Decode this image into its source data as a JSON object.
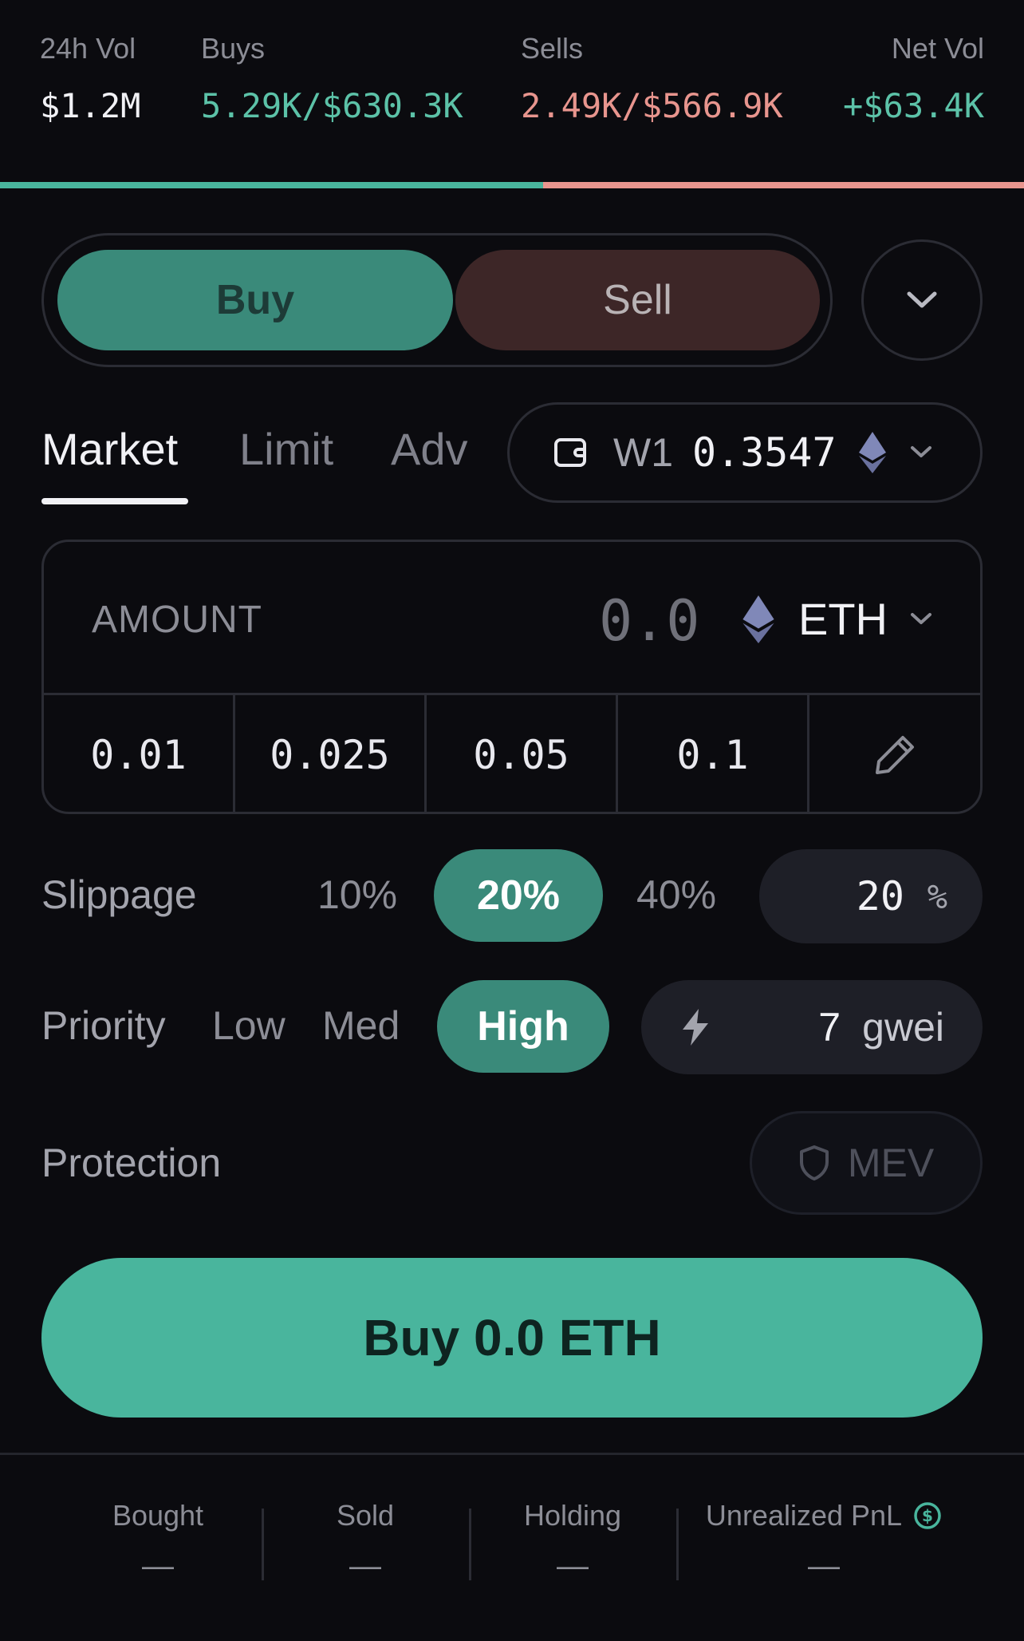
{
  "stats": {
    "vol_label": "24h Vol",
    "vol_value": "$1.2M",
    "buys_label": "Buys",
    "buys_value": "5.29K/$630.3K",
    "sells_label": "Sells",
    "sells_value": "2.49K/$566.9K",
    "net_label": "Net Vol",
    "net_value": "+$63.4K",
    "buy_share": 0.53
  },
  "toggle": {
    "buy_label": "Buy",
    "sell_label": "Sell"
  },
  "order_tabs": {
    "market": "Market",
    "limit": "Limit",
    "adv": "Adv",
    "active": "Market"
  },
  "wallet": {
    "name": "W1",
    "balance": "0.3547",
    "icon": "wallet-icon",
    "token_icon": "eth-icon"
  },
  "amount": {
    "label": "AMOUNT",
    "value": "0.0",
    "token": "ETH"
  },
  "presets": [
    "0.01",
    "0.025",
    "0.05",
    "0.1"
  ],
  "slippage": {
    "label": "Slippage",
    "opt1": "10%",
    "opt2": "20%",
    "opt3": "40%",
    "custom_value": "20",
    "unit": "%"
  },
  "priority": {
    "label": "Priority",
    "low": "Low",
    "med": "Med",
    "high": "High",
    "gas_value": "7",
    "gas_unit": "gwei"
  },
  "protection": {
    "label": "Protection",
    "mev": "MEV"
  },
  "main_button": "Buy 0.0 ETH",
  "footer": {
    "bought_label": "Bought",
    "bought_value": "—",
    "sold_label": "Sold",
    "sold_value": "—",
    "holding_label": "Holding",
    "holding_value": "—",
    "pnl_label": "Unrealized PnL",
    "pnl_value": "—"
  },
  "colors": {
    "buy": "#49b59d",
    "sell": "#e8958e",
    "background": "#0b0b0f"
  }
}
